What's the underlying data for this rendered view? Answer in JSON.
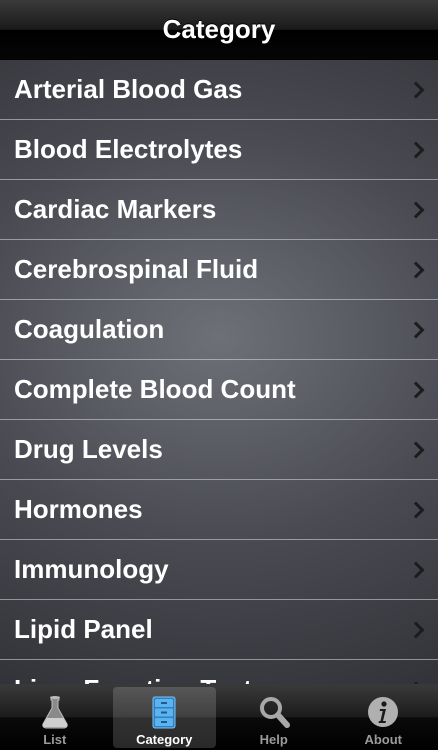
{
  "navbar": {
    "title": "Category"
  },
  "list": {
    "items": [
      {
        "label": "Arterial Blood Gas"
      },
      {
        "label": "Blood Electrolytes"
      },
      {
        "label": "Cardiac Markers"
      },
      {
        "label": "Cerebrospinal Fluid"
      },
      {
        "label": "Coagulation"
      },
      {
        "label": "Complete Blood Count"
      },
      {
        "label": "Drug Levels"
      },
      {
        "label": "Hormones"
      },
      {
        "label": "Immunology"
      },
      {
        "label": "Lipid Panel"
      },
      {
        "label": "Liver Function Tests"
      }
    ]
  },
  "tabbar": {
    "tabs": [
      {
        "label": "List",
        "icon": "flask-icon",
        "selected": false
      },
      {
        "label": "Category",
        "icon": "file-cabinet-icon",
        "selected": true
      },
      {
        "label": "Help",
        "icon": "magnifier-icon",
        "selected": false
      },
      {
        "label": "About",
        "icon": "info-icon",
        "selected": false
      }
    ]
  },
  "colors": {
    "selected_tab_icon": "#4aa3e8",
    "unselected_tab_icon": "#9a9a9a",
    "row_text": "#ffffff",
    "separator": "#c8c8cc"
  }
}
